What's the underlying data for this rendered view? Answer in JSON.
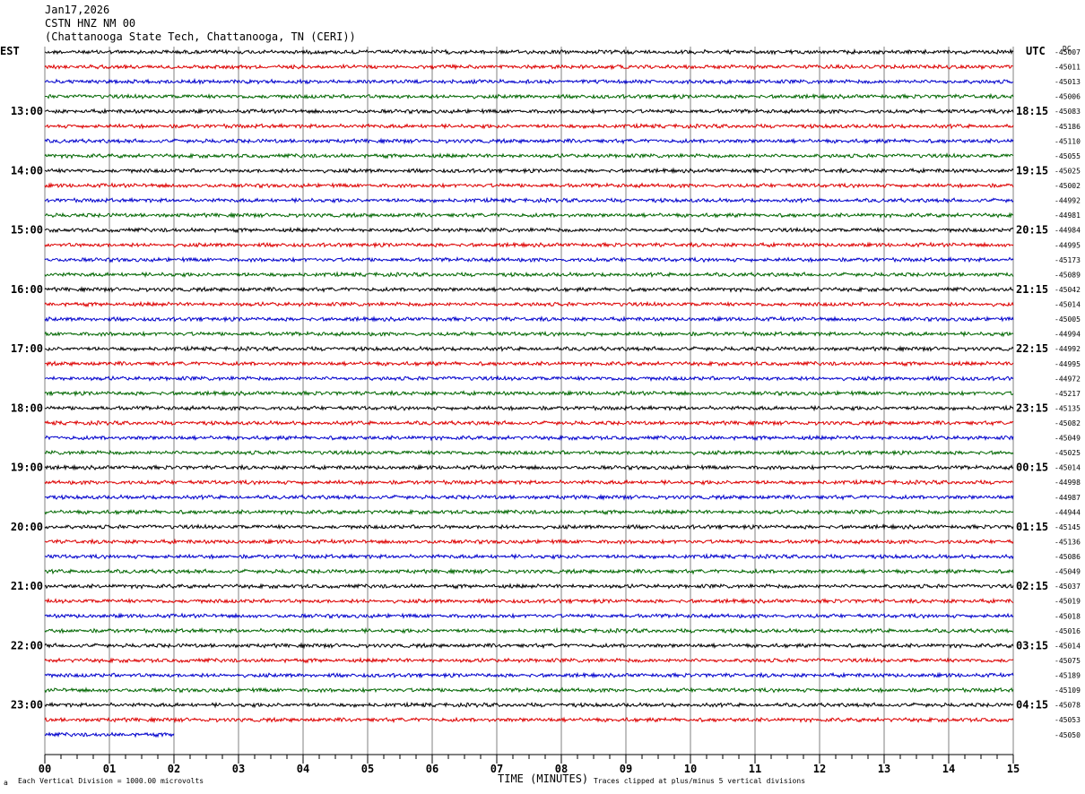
{
  "header": {
    "date": "Jan17,2026",
    "station": "CSTN HNZ NM 00",
    "location": "(Chattanooga State Tech, Chattanooga, TN (CERI))"
  },
  "left_tz": "EST",
  "right_tz": "UTC",
  "dc_label": "DC",
  "footer": {
    "scale": "Each Vertical Division = 1000.00 microvolts",
    "xtitle": "TIME (MINUTES)",
    "clip": "Traces clipped at plus/minus 5 vertical divisions"
  },
  "colors": {
    "trace_cycle": [
      "#000000",
      "#dd0000",
      "#0000cc",
      "#006600"
    ],
    "grid": "#808080"
  },
  "chart_data": {
    "type": "line",
    "title": "CSTN HNZ NM 00",
    "xlabel": "TIME (MINUTES)",
    "ylabel": "",
    "xlim": [
      0,
      15
    ],
    "x_ticks": [
      "00",
      "01",
      "02",
      "03",
      "04",
      "05",
      "06",
      "07",
      "08",
      "09",
      "10",
      "11",
      "12",
      "13",
      "14",
      "15"
    ],
    "grid": true,
    "traces_total": 47,
    "last_trace_end_minute": 2,
    "left_hour_labels": [
      {
        "trace": 4,
        "label": "13:00"
      },
      {
        "trace": 8,
        "label": "14:00"
      },
      {
        "trace": 12,
        "label": "15:00"
      },
      {
        "trace": 16,
        "label": "16:00"
      },
      {
        "trace": 20,
        "label": "17:00"
      },
      {
        "trace": 24,
        "label": "18:00"
      },
      {
        "trace": 28,
        "label": "19:00"
      },
      {
        "trace": 32,
        "label": "20:00"
      },
      {
        "trace": 36,
        "label": "21:00"
      },
      {
        "trace": 40,
        "label": "22:00"
      },
      {
        "trace": 44,
        "label": "23:00"
      }
    ],
    "right_hour_labels": [
      {
        "trace": 4,
        "label": "18:15"
      },
      {
        "trace": 8,
        "label": "19:15"
      },
      {
        "trace": 12,
        "label": "20:15"
      },
      {
        "trace": 16,
        "label": "21:15"
      },
      {
        "trace": 20,
        "label": "22:15"
      },
      {
        "trace": 24,
        "label": "23:15"
      },
      {
        "trace": 28,
        "label": "00:15"
      },
      {
        "trace": 32,
        "label": "01:15"
      },
      {
        "trace": 36,
        "label": "02:15"
      },
      {
        "trace": 40,
        "label": "03:15"
      },
      {
        "trace": 44,
        "label": "04:15"
      }
    ],
    "dc_offsets": [
      "-45007",
      "-45011",
      "-45013",
      "-45006",
      "-45083",
      "-45186",
      "-45110",
      "-45055",
      "-45025",
      "-45002",
      "-44992",
      "-44981",
      "-44984",
      "-44995",
      "-45173",
      "-45089",
      "-45042",
      "-45014",
      "-45005",
      "-44994",
      "-44992",
      "-44995",
      "-44972",
      "-45217",
      "-45135",
      "-45082",
      "-45049",
      "-45025",
      "-45014",
      "-44998",
      "-44987",
      "-44944",
      "-45145",
      "-45136",
      "-45086",
      "-45049",
      "-45037",
      "-45019",
      "-45018",
      "-45016",
      "-45014",
      "-45075",
      "-45189",
      "-45109",
      "-45078",
      "-45053",
      "-45050"
    ]
  }
}
